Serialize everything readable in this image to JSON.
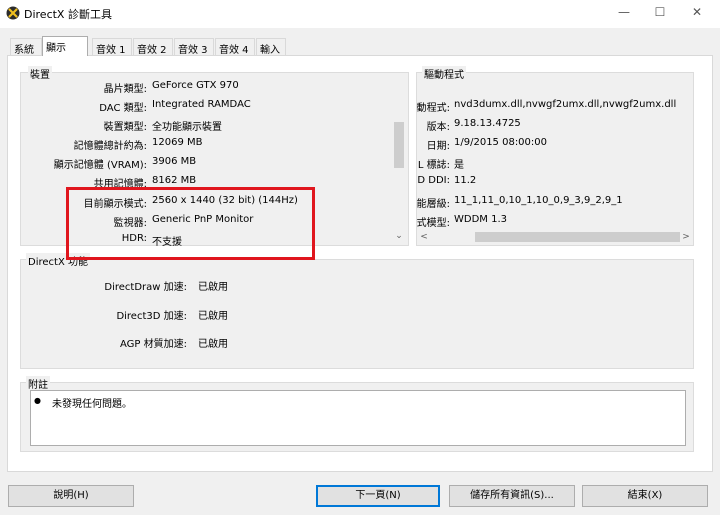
{
  "window": {
    "title": "DirectX 診斷工具",
    "minimize_glyph": "—",
    "maximize_glyph": "☐",
    "close_glyph": "✕",
    "icon": "directx-x-icon"
  },
  "tabs": [
    "系統",
    "顯示",
    "音效 1",
    "音效 2",
    "音效 3",
    "音效 4",
    "輸入"
  ],
  "device": {
    "group_title": "裝置",
    "rows": [
      {
        "label": "晶片類型:",
        "value": "GeForce GTX 970"
      },
      {
        "label": "DAC 類型:",
        "value": "Integrated RAMDAC"
      },
      {
        "label": "裝置類型:",
        "value": "全功能顯示裝置"
      },
      {
        "label": "記憶體總計約為:",
        "value": "12069 MB"
      },
      {
        "label": "顯示記憶體 (VRAM):",
        "value": "3906 MB"
      },
      {
        "label": "共用記憶體:",
        "value": "8162 MB"
      },
      {
        "label": "目前顯示模式:",
        "value": "2560 x 1440 (32 bit) (144Hz)"
      },
      {
        "label": "監視器:",
        "value": "Generic PnP Monitor"
      },
      {
        "label": "HDR:",
        "value": "不支援"
      }
    ]
  },
  "drivers": {
    "group_title": "驅動程式",
    "rows": [
      {
        "label": "動程式:",
        "value": "nvd3dumx.dll,nvwgf2umx.dll,nvwgf2umx.dll"
      },
      {
        "label": "版本:",
        "value": "9.18.13.4725"
      },
      {
        "label": "日期:",
        "value": "1/9/2015 08:00:00"
      },
      {
        "label": "L 標誌:",
        "value": "是"
      },
      {
        "label": "D DDI:",
        "value": "11.2"
      },
      {
        "label": "能層級:",
        "value": "11_1,11_0,10_1,10_0,9_3,9_2,9_1"
      },
      {
        "label": "式模型:",
        "value": "WDDM 1.3"
      }
    ]
  },
  "features": {
    "group_title": "DirectX 功能",
    "rows": [
      {
        "label": "DirectDraw 加速:",
        "value": "已啟用"
      },
      {
        "label": "Direct3D 加速:",
        "value": "已啟用"
      },
      {
        "label": "AGP 材質加速:",
        "value": "已啟用"
      }
    ]
  },
  "notes": {
    "group_title": "附註",
    "items": [
      "未發現任何問題。"
    ]
  },
  "buttons": {
    "help": "說明(H)",
    "next": "下一頁(N)",
    "save": "儲存所有資訊(S)...",
    "exit": "結束(X)"
  },
  "colors": {
    "highlight_box": "#e0161e",
    "default_button_border": "#0078d7"
  }
}
